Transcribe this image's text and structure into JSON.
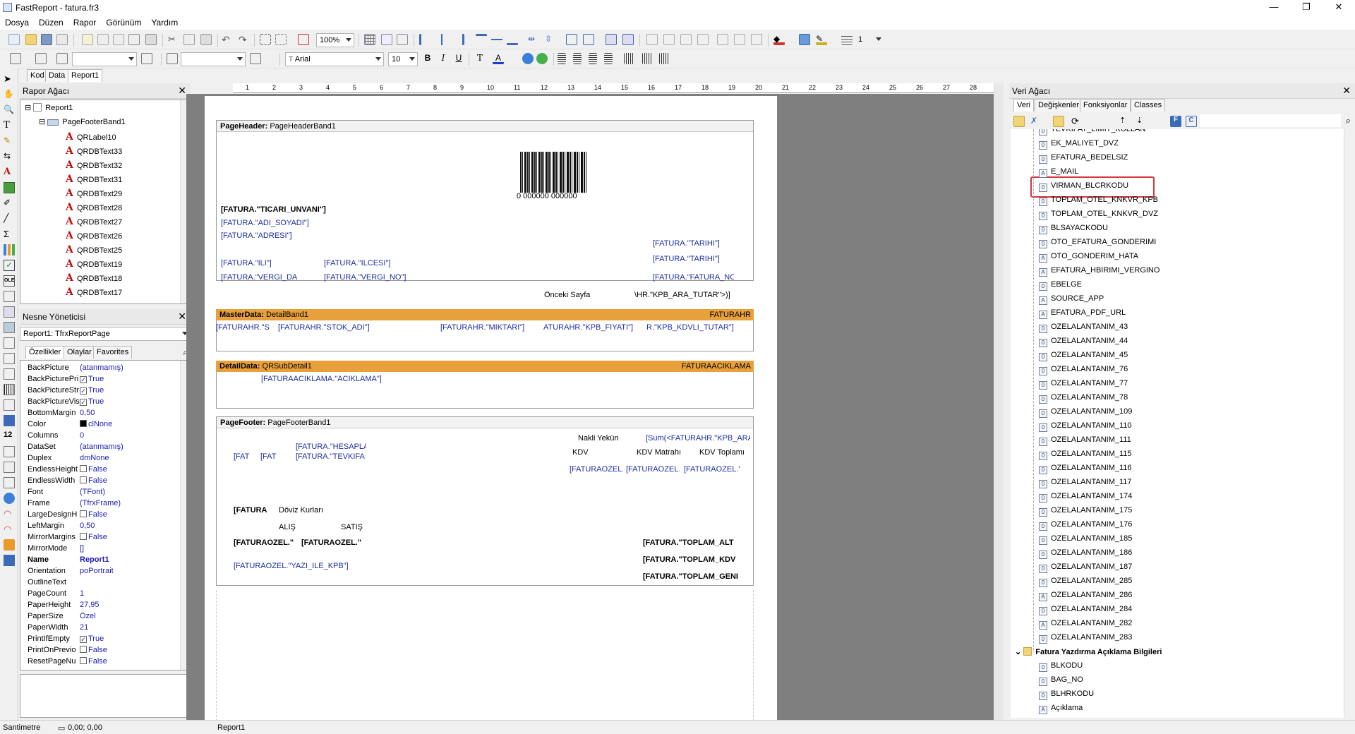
{
  "window": {
    "title": "FastReport - fatura.fr3"
  },
  "menu": [
    "Dosya",
    "Düzen",
    "Rapor",
    "Görünüm",
    "Yardım"
  ],
  "toolbar": {
    "zoom": "100%",
    "font_name": "Arial",
    "font_size": "10",
    "line_width": "1"
  },
  "doc_tabs": [
    "Kod",
    "Data",
    "Report1"
  ],
  "report_tree": {
    "title": "Rapor Ağacı",
    "items": [
      "Report1",
      "PageFooterBand1",
      "QRLabel10",
      "QRDBText33",
      "QRDBText32",
      "QRDBText31",
      "QRDBText29",
      "QRDBText28",
      "QRDBText27",
      "QRDBText26",
      "QRDBText25",
      "QRDBText19",
      "QRDBText18",
      "QRDBText17"
    ]
  },
  "object_inspector": {
    "title": "Nesne Yöneticisi",
    "selected": "Report1: TfrxReportPage",
    "tabs": [
      "Özellikler",
      "Olaylar",
      "Favorites"
    ],
    "props": [
      {
        "name": "BackPicture",
        "value": "(atanmamış)"
      },
      {
        "name": "BackPicturePri",
        "value": "True",
        "check": "✓"
      },
      {
        "name": "BackPictureStr",
        "value": "True",
        "check": "✓"
      },
      {
        "name": "BackPictureVis",
        "value": "True",
        "check": "✓"
      },
      {
        "name": "BottomMargin",
        "value": "0,50"
      },
      {
        "name": "Color",
        "value": "clNone"
      },
      {
        "name": "Columns",
        "value": "0"
      },
      {
        "name": "DataSet",
        "value": "(atanmamış)"
      },
      {
        "name": "Duplex",
        "value": "dmNone"
      },
      {
        "name": "EndlessHeight",
        "value": "False",
        "check": " "
      },
      {
        "name": "EndlessWidth",
        "value": "False",
        "check": " "
      },
      {
        "name": "Font",
        "value": "(TFont)"
      },
      {
        "name": "Frame",
        "value": "(TfrxFrame)"
      },
      {
        "name": "LargeDesignH",
        "value": "False",
        "check": " "
      },
      {
        "name": "LeftMargin",
        "value": "0,50"
      },
      {
        "name": "MirrorMargins",
        "value": "False",
        "check": " "
      },
      {
        "name": "MirrorMode",
        "value": "[]"
      },
      {
        "name": "Name",
        "value": "Report1"
      },
      {
        "name": "Orientation",
        "value": "poPortrait"
      },
      {
        "name": "OutlineText",
        "value": ""
      },
      {
        "name": "PageCount",
        "value": "1"
      },
      {
        "name": "PaperHeight",
        "value": "27,95"
      },
      {
        "name": "PaperSize",
        "value": "Özel"
      },
      {
        "name": "PaperWidth",
        "value": "21"
      },
      {
        "name": "PrintIfEmpty",
        "value": "True",
        "check": "✓"
      },
      {
        "name": "PrintOnPrevio",
        "value": "False",
        "check": " "
      },
      {
        "name": "ResetPageNu",
        "value": "False",
        "check": " "
      }
    ]
  },
  "bands": {
    "page_header": {
      "kind": "PageHeader:",
      "name": "PageHeaderBand1",
      "barcode_text": "0 000000 000000",
      "fields": [
        "[FATURA.\"TICARI_UNVANI\"]",
        "[FATURA.\"ADI_SOYADI\"]",
        "[FATURA.\"ADRESI\"]",
        "[FATURA.\"ILI\"]",
        "[FATURA.\"VERGI_DA",
        "[FATURA.\"ILCESI\"]",
        "[FATURA.\"VERGI_NO\"]",
        "[FATURA.\"TARIHI\"]",
        "[FATURA.\"TARIHI\"]",
        "[FATURA.\"FATURA_NC",
        "Önceki Sayfa",
        "\\HR.\"KPB_ARA_TUTAR\">)]"
      ]
    },
    "master": {
      "kind": "MasterData:",
      "name": "DetailBand1",
      "source": "FATURAHR",
      "fields": [
        "[FATURAHR.\"S",
        "[FATURAHR.\"STOK_ADI\"]",
        "[FATURAHR.\"MIKTARI\"]",
        "ATURAHR.\"KPB_FIYATI\"]",
        "R.\"KPB_KDVLI_TUTAR\"]"
      ]
    },
    "detail": {
      "kind": "DetailData:",
      "name": "QRSubDetail1",
      "source": "FATURAACIKLAMA",
      "fields": [
        "[FATURAACIKLAMA.\"ACIKLAMA\"]"
      ]
    },
    "footer": {
      "kind": "PageFooter:",
      "name": "PageFooterBand1",
      "fields": [
        "Nakli Yekün",
        "[Sum(<FATURAHR.\"KPB_ARA",
        "[FAT",
        "[FAT",
        "[FATURA.\"HESAPLA",
        "[FATURA.\"TEVKIFA",
        "KDV",
        "KDV Matrahı",
        "KDV Toplamı",
        "[FATURAOZEL.'",
        "[FATURAOZEL.'",
        "[FATURAOZEL.\"",
        "[FATURA",
        "Döviz Kurları",
        "ALIŞ",
        "SATIŞ",
        "[FATURAOZEL.\"",
        "[FATURAOZEL.\"",
        "[FATURA.\"TOPLAM_ALT",
        "[FATURA.\"TOPLAM_KDV",
        "[FATURA.\"TOPLAM_GENI",
        "[FATURAOZEL.\"YAZI_ILE_KPB\"]"
      ]
    }
  },
  "data_tree": {
    "title": "Veri Ağacı",
    "tabs": [
      "Veri",
      "Değişkenler",
      "Fonksiyonlar",
      "Classes"
    ],
    "items": [
      {
        "label": "TEVKIFAT_LIMIT_KULLAN",
        "t": "f"
      },
      {
        "label": "EK_MALIYET_DVZ",
        "t": "f"
      },
      {
        "label": "EFATURA_BEDELSIZ",
        "t": "f"
      },
      {
        "label": "E_MAIL",
        "t": "a"
      },
      {
        "label": "VIRMAN_BLCRKODU",
        "t": "f"
      },
      {
        "label": "TOPLAM_OTEL_KNKVR_KPB",
        "t": "f"
      },
      {
        "label": "TOPLAM_OTEL_KNKVR_DVZ",
        "t": "f"
      },
      {
        "label": "BLSAYACKODU",
        "t": "f"
      },
      {
        "label": "OTO_EFATURA_GONDERIMI",
        "t": "f"
      },
      {
        "label": "OTO_GONDERIM_HATA",
        "t": "a"
      },
      {
        "label": "EFATURA_HBIRIMI_VERGINO",
        "t": "a"
      },
      {
        "label": "EBELGE",
        "t": "f"
      },
      {
        "label": "SOURCE_APP",
        "t": "a"
      },
      {
        "label": "EFATURA_PDF_URL",
        "t": "a"
      },
      {
        "label": "OZELALANTANIM_43",
        "t": "f"
      },
      {
        "label": "OZELALANTANIM_44",
        "t": "f"
      },
      {
        "label": "OZELALANTANIM_45",
        "t": "f"
      },
      {
        "label": "OZELALANTANIM_76",
        "t": "f"
      },
      {
        "label": "OZELALANTANIM_77",
        "t": "f"
      },
      {
        "label": "OZELALANTANIM_78",
        "t": "f"
      },
      {
        "label": "OZELALANTANIM_109",
        "t": "f"
      },
      {
        "label": "OZELALANTANIM_110",
        "t": "f"
      },
      {
        "label": "OZELALANTANIM_111",
        "t": "f"
      },
      {
        "label": "OZELALANTANIM_115",
        "t": "f"
      },
      {
        "label": "OZELALANTANIM_116",
        "t": "f"
      },
      {
        "label": "OZELALANTANIM_117",
        "t": "f"
      },
      {
        "label": "OZELALANTANIM_174",
        "t": "f"
      },
      {
        "label": "OZELALANTANIM_175",
        "t": "f"
      },
      {
        "label": "OZELALANTANIM_176",
        "t": "f"
      },
      {
        "label": "OZELALANTANIM_185",
        "t": "f"
      },
      {
        "label": "OZELALANTANIM_186",
        "t": "f"
      },
      {
        "label": "OZELALANTANIM_187",
        "t": "f"
      },
      {
        "label": "OZELALANTANIM_285",
        "t": "f"
      },
      {
        "label": "OZELALANTANIM_286",
        "t": "a"
      },
      {
        "label": "OZELALANTANIM_284",
        "t": "f"
      },
      {
        "label": "OZELALANTANIM_282",
        "t": "a"
      },
      {
        "label": "OZELALANTANIM_283",
        "t": "f"
      }
    ],
    "group": "Fatura Yazdırma Açıklama Bilgileri",
    "group_items": [
      {
        "label": "BLKODU",
        "t": "f"
      },
      {
        "label": "BAG_NO",
        "t": "f"
      },
      {
        "label": "BLHRKODU",
        "t": "f"
      },
      {
        "label": "Açıklama",
        "t": "a"
      }
    ]
  },
  "status": {
    "units": "Santimetre",
    "coords": "0,00; 0,00",
    "page": "Report1"
  },
  "colors": {
    "band_orange": "#e8a13a",
    "field_blue": "#1c2fa0",
    "highlight": "#d9363e"
  }
}
